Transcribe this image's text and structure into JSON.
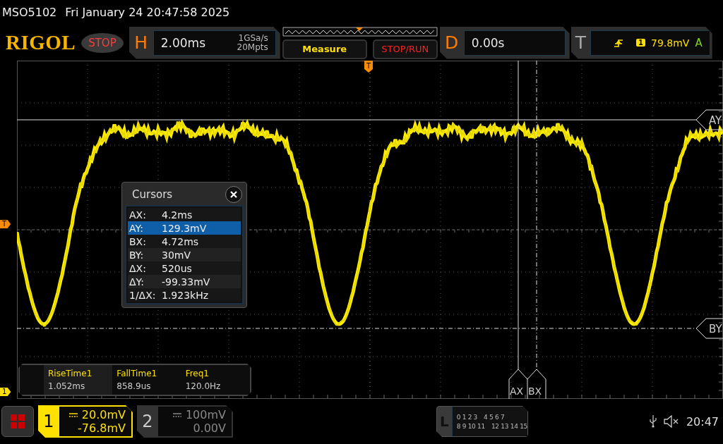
{
  "status_line": {
    "model": "MSO5102",
    "datetime": "Fri January 24 20:47:58 2025"
  },
  "toolbar": {
    "logo": "RIGOL",
    "run_state": "STOP",
    "horizontal": {
      "label": "H",
      "timebase": "2.00ms",
      "sample_rate": "1GSa/s",
      "memory_depth": "20Mpts"
    },
    "buttons": [
      {
        "label": "Measure",
        "kind": "measure"
      },
      {
        "label": "STOP/RUN",
        "kind": "stoprun"
      }
    ],
    "delay": {
      "label": "D",
      "value": "0.00s"
    },
    "trigger": {
      "label": "T",
      "source": "1",
      "level": "79.8mV",
      "mode": "A"
    }
  },
  "display": {
    "trigger_position": "T",
    "trigger_level": "T",
    "channel_marker": "1",
    "cursor_labels": {
      "ay": "AY",
      "by": "BY",
      "ax": "AX",
      "bx": "BX"
    }
  },
  "cursors_dialog": {
    "title": "Cursors",
    "rows": [
      {
        "name": "AX:",
        "value": "4.2ms",
        "selected": false
      },
      {
        "name": "AY:",
        "value": "129.3mV",
        "selected": true
      },
      {
        "name": "BX:",
        "value": "4.72ms",
        "selected": false
      },
      {
        "name": "BY:",
        "value": "30mV",
        "selected": false
      },
      {
        "name": "ΔX:",
        "value": "520us",
        "selected": false
      },
      {
        "name": "ΔY:",
        "value": "-99.33mV",
        "selected": false
      },
      {
        "name": "1/ΔX:",
        "value": "1.923kHz",
        "selected": false
      }
    ]
  },
  "measurements": [
    {
      "name": "RiseTime1",
      "value": "1.052ms",
      "selected": true
    },
    {
      "name": "FallTime1",
      "value": "858.9us",
      "selected": false
    },
    {
      "name": "Freq1",
      "value": "120.0Hz",
      "selected": false
    }
  ],
  "channels": [
    {
      "number": "1",
      "scale": "20.0mV",
      "offset": "-76.8mV",
      "active": true
    },
    {
      "number": "2",
      "scale": "100mV",
      "offset": "0.00V",
      "active": false
    }
  ],
  "logic": {
    "label": "L",
    "rows": [
      [
        "0 1 2 3",
        "4 5 6 7"
      ],
      [
        "8 9 10 11",
        "12 13 14 15"
      ]
    ]
  },
  "clock": "20:47"
}
